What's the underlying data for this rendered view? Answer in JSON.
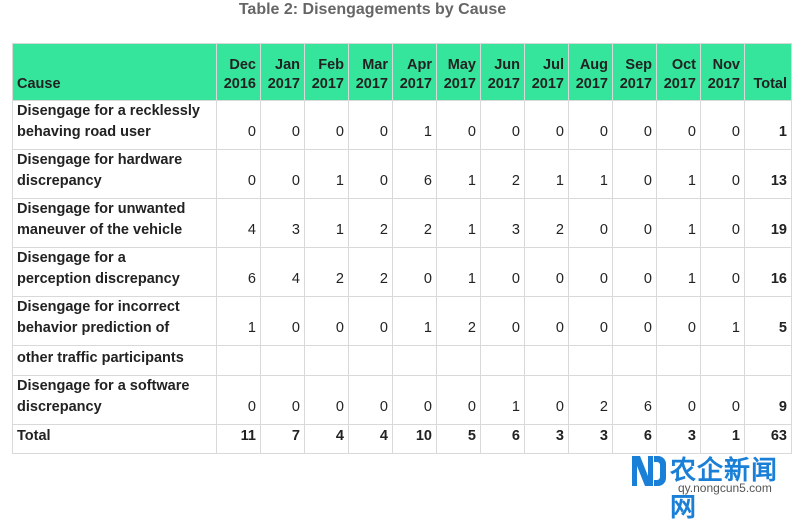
{
  "title": "Table 2:  Disengagements by Cause",
  "header": {
    "cause": "Cause",
    "months": [
      [
        "Dec",
        "2016"
      ],
      [
        "Jan",
        "2017"
      ],
      [
        "Feb",
        "2017"
      ],
      [
        "Mar",
        "2017"
      ],
      [
        "Apr",
        "2017"
      ],
      [
        "May",
        "2017"
      ],
      [
        "Jun",
        "2017"
      ],
      [
        "Jul",
        "2017"
      ],
      [
        "Aug",
        "2017"
      ],
      [
        "Sep",
        "2017"
      ],
      [
        "Oct",
        "2017"
      ],
      [
        "Nov",
        "2017"
      ]
    ],
    "total": "Total"
  },
  "rows": [
    {
      "cause": [
        "Disengage for a recklessly",
        "behaving road user"
      ],
      "values": [
        0,
        0,
        0,
        0,
        1,
        0,
        0,
        0,
        0,
        0,
        0,
        0
      ],
      "total": 1
    },
    {
      "cause": [
        "Disengage for hardware",
        "discrepancy"
      ],
      "values": [
        0,
        0,
        1,
        0,
        6,
        1,
        2,
        1,
        1,
        0,
        1,
        0
      ],
      "total": 13
    },
    {
      "cause": [
        "Disengage for unwanted",
        "maneuver of the vehicle"
      ],
      "values": [
        4,
        3,
        1,
        2,
        2,
        1,
        3,
        2,
        0,
        0,
        1,
        0
      ],
      "total": 19
    },
    {
      "cause": [
        "Disengage for a",
        "perception discrepancy"
      ],
      "values": [
        6,
        4,
        2,
        2,
        0,
        1,
        0,
        0,
        0,
        0,
        1,
        0
      ],
      "total": 16
    },
    {
      "cause": [
        "Disengage for incorrect",
        "behavior prediction of"
      ],
      "values": [
        1,
        0,
        0,
        0,
        1,
        2,
        0,
        0,
        0,
        0,
        0,
        1
      ],
      "total": 5
    },
    {
      "cause": [
        "other traffic participants"
      ],
      "values": [],
      "total": null
    },
    {
      "cause": [
        "Disengage for a software",
        "discrepancy"
      ],
      "values": [
        0,
        0,
        0,
        0,
        0,
        0,
        1,
        0,
        2,
        6,
        0,
        0
      ],
      "total": 9
    }
  ],
  "totals": {
    "label": "Total",
    "values": [
      11,
      7,
      4,
      4,
      10,
      5,
      6,
      3,
      3,
      6,
      3,
      1
    ],
    "total": 63
  },
  "watermark": {
    "name": "农企新闻网",
    "url": "qy.nongcun5.com"
  },
  "colors": {
    "header": "#35e59c",
    "watermark": "#1a7fd6"
  }
}
